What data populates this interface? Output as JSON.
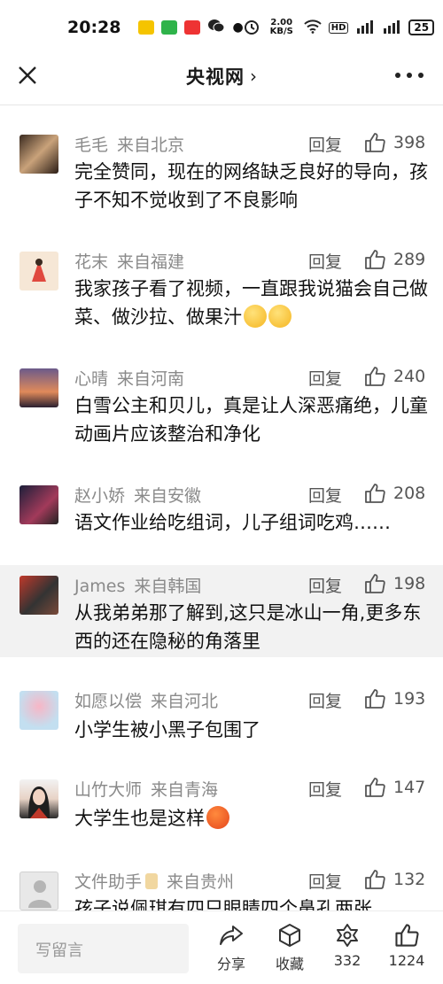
{
  "status_bar": {
    "time": "20:28",
    "net_speed": "2.00 KB/S",
    "battery": "25"
  },
  "header": {
    "title": "央视网",
    "chevron": "›"
  },
  "comments": [
    {
      "user": "毛毛",
      "location": "来自北京",
      "reply": "回复",
      "likes": "398",
      "text": "完全赞同，现在的网络缺乏良好的导向，孩子不知不觉收到了不良影响"
    },
    {
      "user": "花末",
      "location": "来自福建",
      "reply": "回复",
      "likes": "289",
      "text": "我家孩子看了视频，一直跟我说猫会自己做菜、做沙拉、做果汁",
      "emoji": "smile-emoji ×2"
    },
    {
      "user": "心晴",
      "location": "来自河南",
      "reply": "回复",
      "likes": "240",
      "text": "白雪公主和贝儿，真是让人深恶痛绝，儿童动画片应该整治和净化"
    },
    {
      "user": "赵小娇",
      "location": "来自安徽",
      "reply": "回复",
      "likes": "208",
      "text": "语文作业给吃组词，儿子组词吃鸡……"
    },
    {
      "user": "James",
      "location": "来自韩国",
      "reply": "回复",
      "likes": "198",
      "text": "从我弟弟那了解到,这只是冰山一角,更多东西的还在隐秘的角落里"
    },
    {
      "user": "如愿以偿",
      "location": "来自河北",
      "reply": "回复",
      "likes": "193",
      "text": "小学生被小黑子包围了"
    },
    {
      "user": "山竹大师",
      "location": "来自青海",
      "reply": "回复",
      "likes": "147",
      "text": "大学生也是这样",
      "emoji": "angry-emoji"
    },
    {
      "user": "文件助手",
      "location": "来自贵州",
      "reply": "回复",
      "likes": "132",
      "text": "孩子说佩琪有四只眼睛四个鼻孔两张"
    }
  ],
  "bottom_bar": {
    "input_placeholder": "写留言",
    "share_label": "分享",
    "collect_label": "收藏",
    "comment_count": "332",
    "like_count": "1224"
  },
  "colors": {
    "highlight_row": "#f2f2f2",
    "meta_gray": "#8a8a8a"
  }
}
